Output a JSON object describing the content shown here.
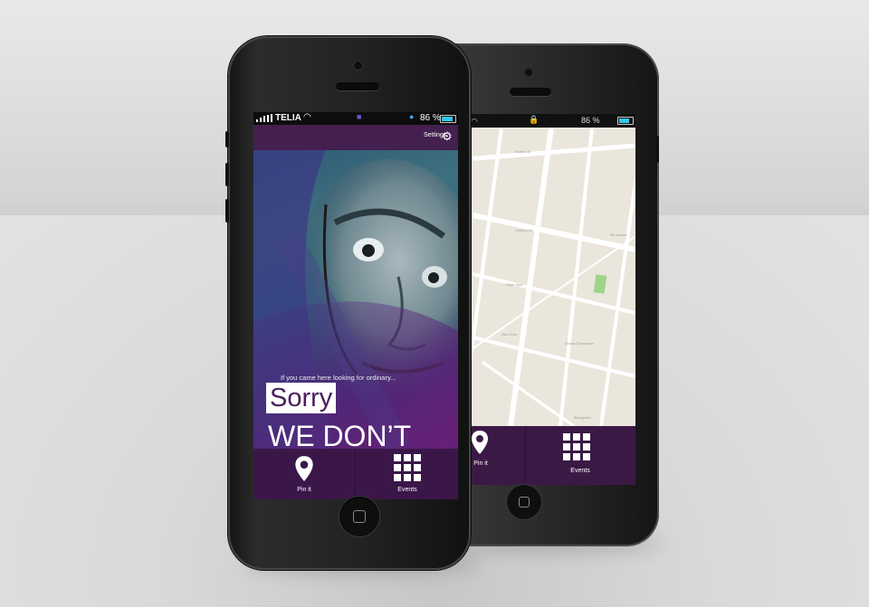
{
  "front_phone": {
    "status_bar": {
      "carrier": "TELIA",
      "battery_percent": "86 %"
    },
    "top_bar": {
      "settings_label": "Settings"
    },
    "hero": {
      "tagline": "If you came here looking for ordinary...",
      "highlight": "Sorry",
      "headline": "WE DON’T DO ORDINARY"
    },
    "nav": [
      {
        "label": "Pin it",
        "icon": "map-pin-icon"
      },
      {
        "label": "Events",
        "icon": "grid-icon"
      }
    ]
  },
  "back_phone": {
    "status_bar": {
      "battery_percent": "86 %"
    },
    "nav": [
      {
        "label": "Pin it",
        "icon": "map-pin-icon"
      },
      {
        "label": "Events",
        "icon": "grid-icon"
      }
    ]
  },
  "colors": {
    "brand_purple": "#43204f",
    "nav_purple": "#3a1748",
    "sorry_text": "#4a1d5c",
    "battery": "#31c7f0",
    "map_park": "#9fd58a"
  }
}
